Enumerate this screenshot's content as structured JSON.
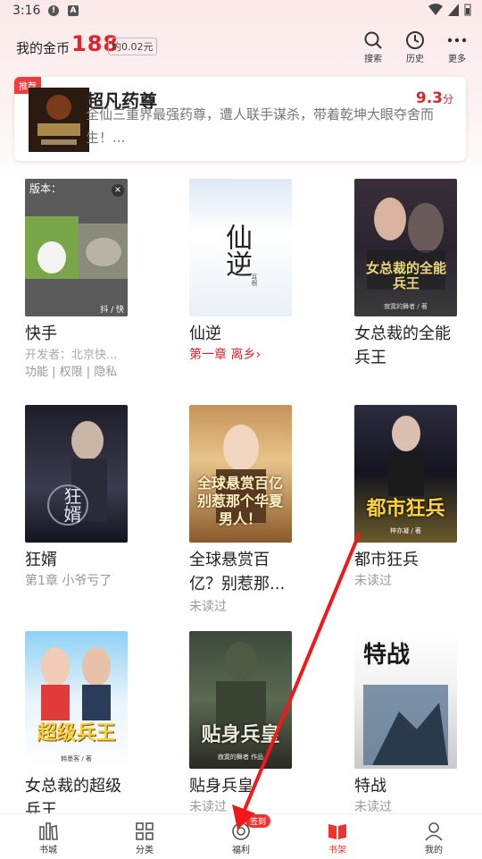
{
  "status": {
    "time": "3:16",
    "dot_icon": "!",
    "a_icon": "A"
  },
  "header": {
    "coin_label": "我的金币",
    "coin_value": "188",
    "coin_approx": "约0.02元",
    "search_label": "搜索",
    "history_label": "历史",
    "more_label": "更多"
  },
  "recommend": {
    "tag": "推荐",
    "title": "超凡药尊",
    "desc": "全仙三重界最强药尊，遭人联手谋杀，带着乾坤大眼夺舍而生！...",
    "score": "9.3",
    "score_unit": "分"
  },
  "books": [
    {
      "title": "快手",
      "sub1": "开发者：北京快...",
      "sub2": "功能 | 权限 | 隐私",
      "ad_label": "版本：",
      "ad_brand": "抖 / 快"
    },
    {
      "title": "仙逆",
      "sub1": "第一章 离乡",
      "chevron": "›",
      "cover_text": "仙逆",
      "cover_author": "耳根"
    },
    {
      "title": "女总裁的全能兵王",
      "sub1": "",
      "cover_text": "女总裁的全能兵王",
      "cover_author": "寂寞的舞者 / 著"
    },
    {
      "title": "狂婿",
      "sub1": "第1章 小爷亏了",
      "cover_text": "狂婿"
    },
    {
      "title": "全球悬赏百亿？别惹那...",
      "sub1": "未读过",
      "cover_text": "全球悬赏百亿 别惹那个华夏男人！"
    },
    {
      "title": "都市狂兵",
      "sub1": "未读过",
      "cover_text": "都市狂兵",
      "cover_author": "梓亦凝 / 著"
    },
    {
      "title": "女总裁的超级兵王",
      "sub1": "",
      "cover_text": "超级兵王",
      "cover_author": "韩墨客 / 著"
    },
    {
      "title": "贴身兵皇",
      "sub1": "未读过",
      "cover_text": "贴身兵皇",
      "cover_author": "寂寞的舞者 作品"
    },
    {
      "title": "特战",
      "sub1": "未读过",
      "cover_text": "特战"
    }
  ],
  "nav": {
    "bookstore": "书城",
    "category": "分类",
    "welfare": "福利",
    "shelf": "书架",
    "mine": "我的",
    "badge": "签到"
  },
  "colors": {
    "accent": "#d9262f",
    "card_bg": "#ffffff"
  }
}
